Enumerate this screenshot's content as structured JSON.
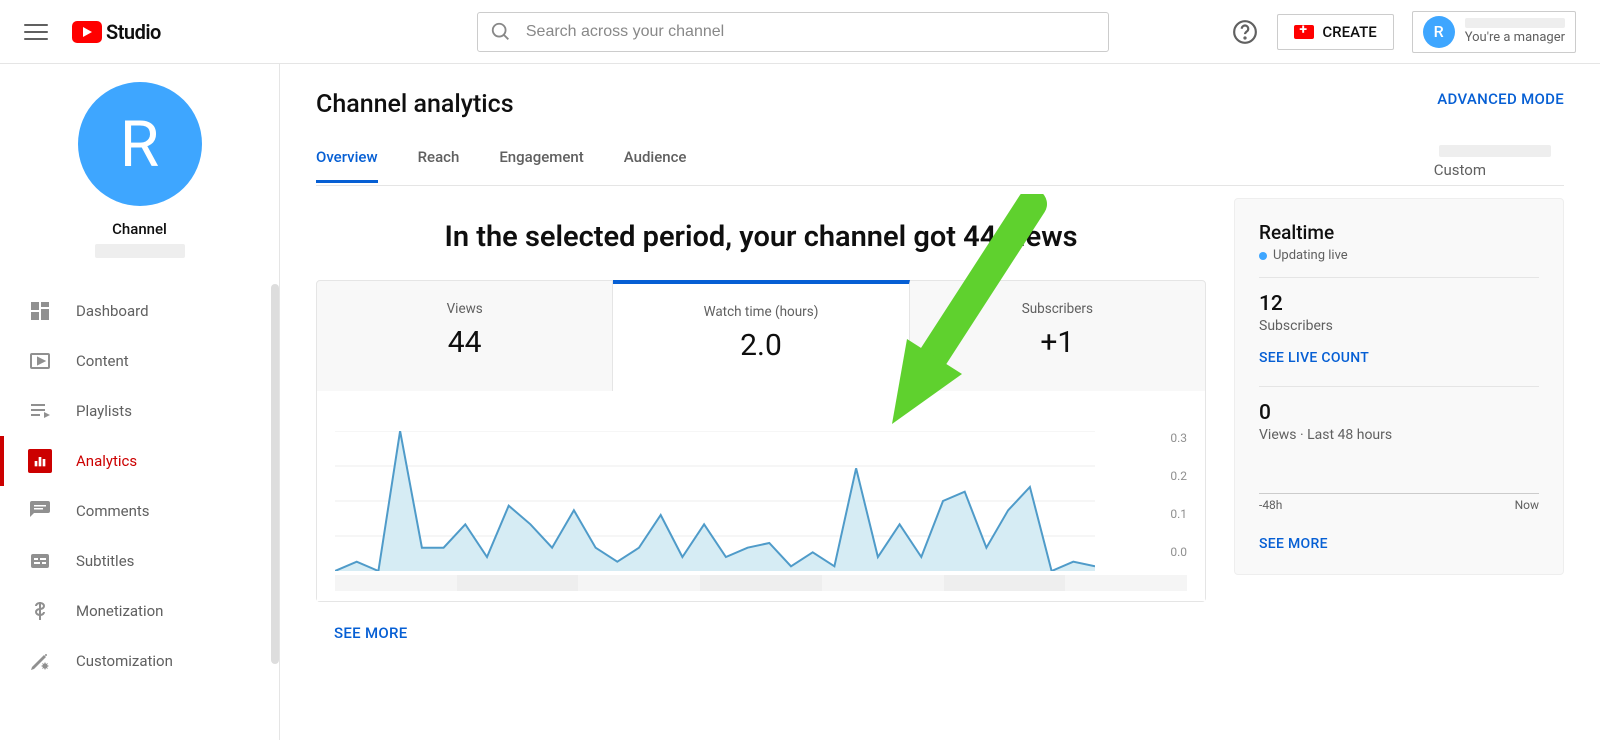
{
  "brand": {
    "name": "Studio"
  },
  "search": {
    "placeholder": "Search across your channel"
  },
  "header": {
    "create": "CREATE",
    "role": "You're a manager",
    "avatar_initial": "R"
  },
  "sidebar": {
    "avatar_initial": "R",
    "channel_label": "Channel",
    "items": [
      {
        "label": "Dashboard"
      },
      {
        "label": "Content"
      },
      {
        "label": "Playlists"
      },
      {
        "label": "Analytics"
      },
      {
        "label": "Comments"
      },
      {
        "label": "Subtitles"
      },
      {
        "label": "Monetization"
      },
      {
        "label": "Customization"
      }
    ]
  },
  "page": {
    "title": "Channel analytics",
    "advanced": "ADVANCED MODE",
    "tabs": [
      "Overview",
      "Reach",
      "Engagement",
      "Audience"
    ],
    "range_label": "Custom",
    "headline": "In the selected period, your channel got 44 views",
    "see_more": "SEE MORE"
  },
  "metrics": [
    {
      "label": "Views",
      "value": "44"
    },
    {
      "label": "Watch time (hours)",
      "value": "2.0"
    },
    {
      "label": "Subscribers",
      "value": "+1"
    }
  ],
  "realtime": {
    "title": "Realtime",
    "updating": "Updating live",
    "subs_value": "12",
    "subs_label": "Subscribers",
    "live_count": "SEE LIVE COUNT",
    "views_value": "0",
    "views_label": "Views · Last 48 hours",
    "range_start": "-48h",
    "range_end": "Now",
    "see_more": "SEE MORE"
  },
  "chart_data": {
    "type": "area",
    "title": "Watch time (hours)",
    "ylabel": "",
    "ylim": [
      0.0,
      0.3
    ],
    "y_ticks": [
      "0.3",
      "0.2",
      "0.1",
      "0.0"
    ],
    "x": [
      0,
      1,
      2,
      3,
      4,
      5,
      6,
      7,
      8,
      9,
      10,
      11,
      12,
      13,
      14,
      15,
      16,
      17,
      18,
      19,
      20,
      21,
      22,
      23,
      24,
      25,
      26,
      27,
      28,
      29,
      30,
      31,
      32,
      33,
      34,
      35
    ],
    "values": [
      0.0,
      0.02,
      0.0,
      0.3,
      0.05,
      0.05,
      0.1,
      0.03,
      0.14,
      0.1,
      0.05,
      0.13,
      0.05,
      0.02,
      0.05,
      0.12,
      0.03,
      0.1,
      0.03,
      0.05,
      0.06,
      0.01,
      0.04,
      0.01,
      0.22,
      0.03,
      0.1,
      0.03,
      0.15,
      0.17,
      0.05,
      0.13,
      0.18,
      0.0,
      0.02,
      0.01
    ]
  }
}
